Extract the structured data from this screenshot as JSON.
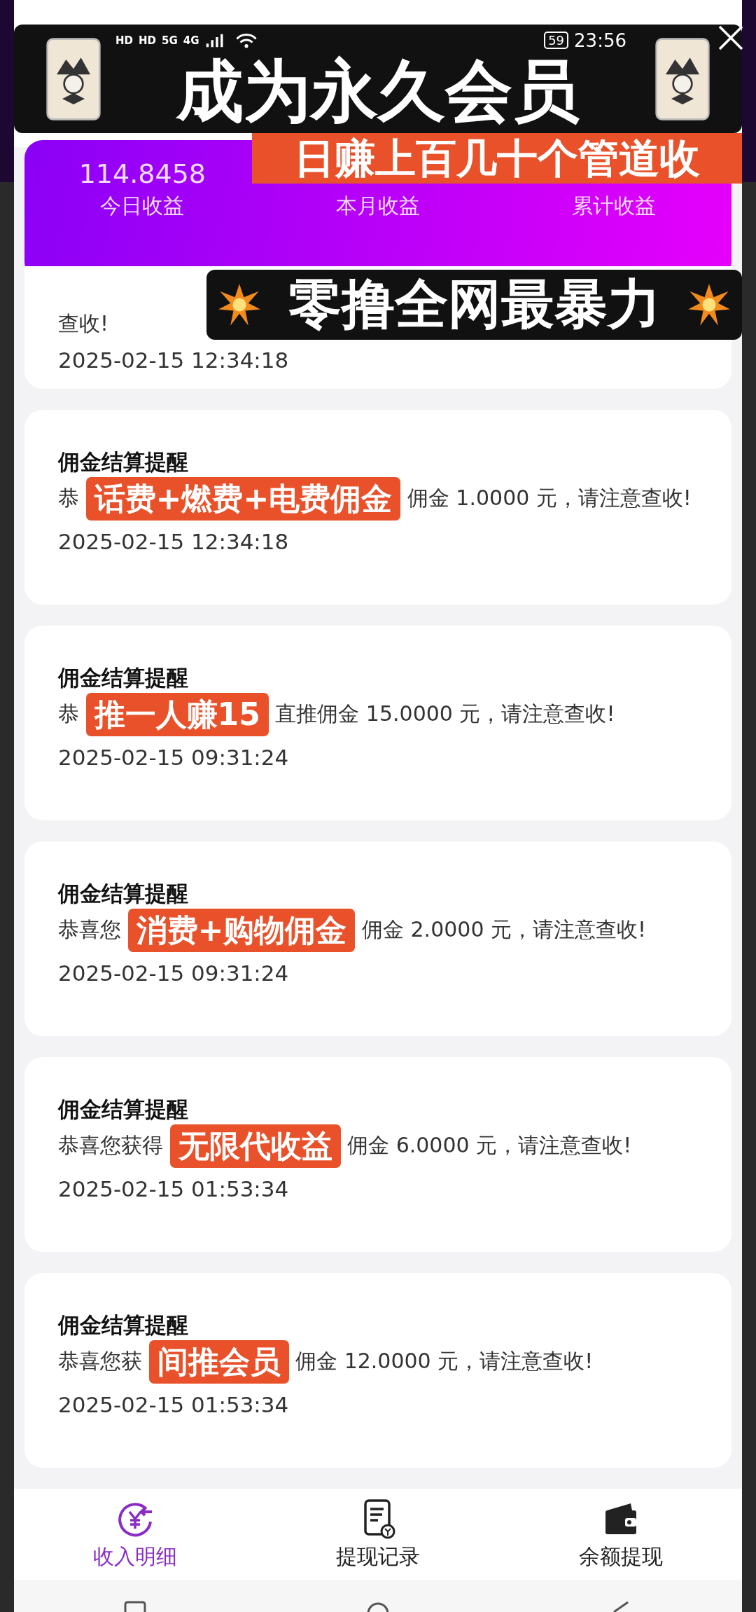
{
  "status_bar": {
    "network_labels": [
      "HD",
      "HD",
      "5G",
      "4G"
    ],
    "battery": "59",
    "time": "23:56"
  },
  "overlay_captions": {
    "banner": "成为永久会员",
    "top": "日赚上百几十个管道收",
    "middle": "零撸全网最暴力"
  },
  "summary": {
    "stats": [
      {
        "value": "114.8458",
        "label": "今日收益"
      },
      {
        "label": "本月收益"
      },
      {
        "label": "累计收益"
      }
    ]
  },
  "notifications": [
    {
      "message_after": "查收!",
      "time": "2025-02-15 12:34:18"
    },
    {
      "title": "佣金结算提醒",
      "message_before": "恭",
      "caption": "话费+燃费+电费佣金",
      "message_after": "佣金 1.0000 元，请注意查收!",
      "time": "2025-02-15 12:34:18"
    },
    {
      "title": "佣金结算提醒",
      "message_before": "恭",
      "caption": "推一人赚15",
      "message_after": "直推佣金 15.0000 元，请注意查收!",
      "time": "2025-02-15 09:31:24"
    },
    {
      "title": "佣金结算提醒",
      "message_before": "恭喜您",
      "caption": "消费+购物佣金",
      "message_after": "佣金 2.0000 元，请注意查收!",
      "time": "2025-02-15 09:31:24"
    },
    {
      "title": "佣金结算提醒",
      "message_before": "恭喜您获得",
      "caption": "无限代收益",
      "message_after": "佣金 6.0000 元，请注意查收!",
      "time": "2025-02-15 01:53:34"
    },
    {
      "title": "佣金结算提醒",
      "message_before": "恭喜您获",
      "caption": "间推会员",
      "message_after": "佣金 12.0000 元，请注意查收!",
      "time": "2025-02-15 01:53:34"
    }
  ],
  "bottom_nav": [
    {
      "label": "收入明细",
      "kind": "income",
      "selected": true
    },
    {
      "label": "提现记录",
      "kind": "records",
      "selected": false
    },
    {
      "label": "余额提现",
      "kind": "wallet",
      "selected": false
    }
  ]
}
